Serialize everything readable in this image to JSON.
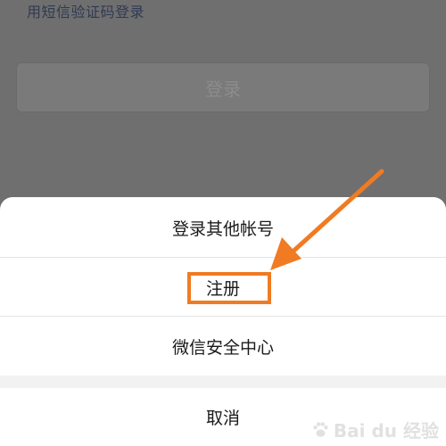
{
  "background": {
    "sms_login_link": "用短信验证码登录",
    "login_button": "登录"
  },
  "action_sheet": {
    "items": [
      {
        "label": "登录其他帐号"
      },
      {
        "label": "注册"
      },
      {
        "label": "微信安全中心"
      }
    ],
    "cancel": "取消"
  },
  "annotation": {
    "color": "#f07b22"
  },
  "watermark": {
    "text": "Bai du 经验"
  }
}
